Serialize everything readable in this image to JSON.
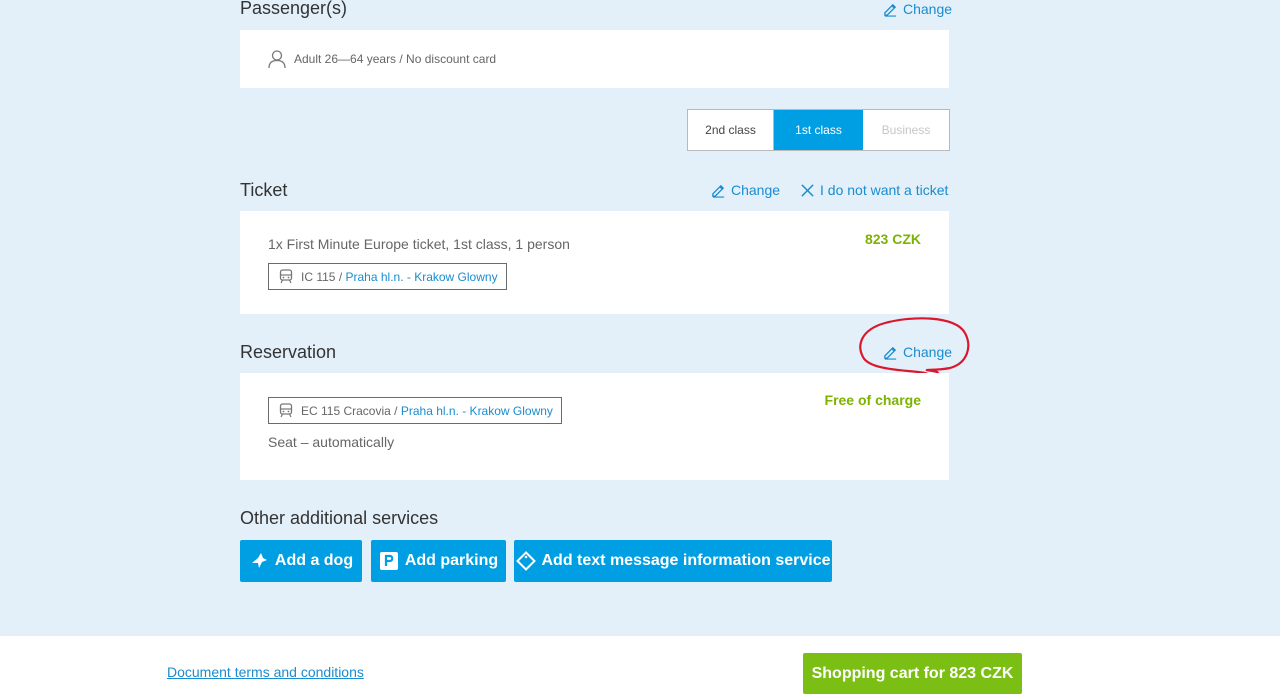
{
  "passengers": {
    "title": "Passenger(s)",
    "change_label": "Change",
    "passenger_text": "Adult 26—64 years / No discount card"
  },
  "class_selector": {
    "options": [
      "2nd class",
      "1st class",
      "Business"
    ],
    "selected": "1st class"
  },
  "ticket": {
    "title": "Ticket",
    "change_label": "Change",
    "remove_label": "I do not want a ticket",
    "description": "1x First Minute Europe ticket, 1st class, 1 person",
    "price": "823 CZK",
    "train": "IC 115",
    "separator": "/",
    "route": "Praha hl.n. - Krakow Glowny"
  },
  "reservation": {
    "title": "Reservation",
    "change_label": "Change",
    "train": "EC 115 Cracovia",
    "separator": "/",
    "route": "Praha hl.n. - Krakow Glowny",
    "seat": "Seat – automatically",
    "price": "Free of charge"
  },
  "additional_services": {
    "title": "Other additional services",
    "buttons": [
      "Add a dog",
      "Add parking",
      "Add text message information service"
    ]
  },
  "footer": {
    "terms_label": "Document terms and conditions",
    "cart_label": "Shopping cart for 823 CZK"
  },
  "colors": {
    "accent_blue": "#009fe3",
    "link_blue": "#1a8ccf",
    "price_green": "#7cb300",
    "cart_green": "#7cbf14",
    "page_bg": "#e3f0fa",
    "annotation_red": "#d9182d"
  }
}
